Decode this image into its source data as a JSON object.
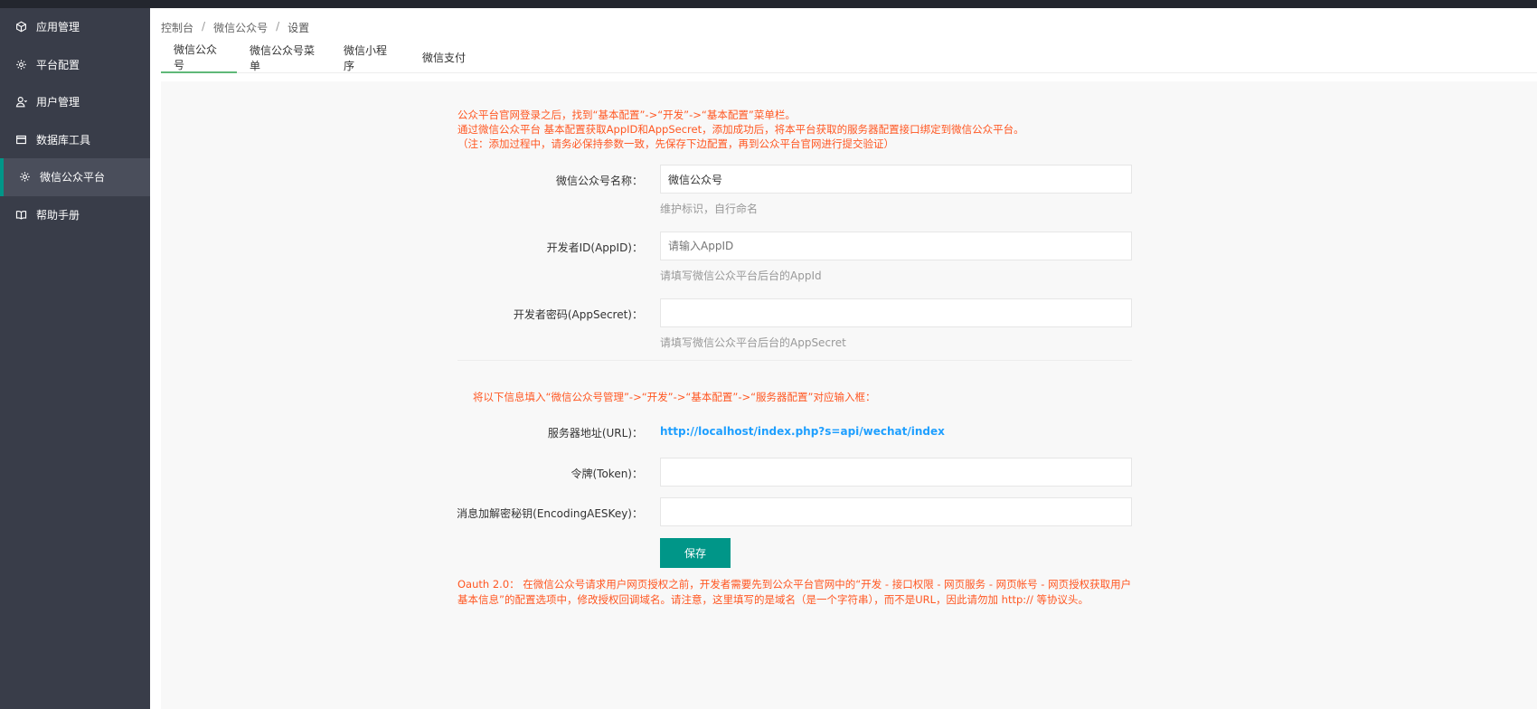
{
  "sidebar": {
    "items": [
      {
        "label": "应用管理",
        "icon": "cube-icon"
      },
      {
        "label": "平台配置",
        "icon": "gear-icon"
      },
      {
        "label": "用户管理",
        "icon": "user-icon"
      },
      {
        "label": "数据库工具",
        "icon": "window-icon"
      },
      {
        "label": "微信公众平台",
        "icon": "gear-icon",
        "active": true
      },
      {
        "label": "帮助手册",
        "icon": "book-icon"
      }
    ]
  },
  "breadcrumb": [
    "控制台",
    "微信公众号",
    "设置"
  ],
  "breadcrumb_sep": "/",
  "tabs": [
    "微信公众号",
    "微信公众号菜单",
    "微信小程序",
    "微信支付"
  ],
  "notice_top": [
    "公众平台官网登录之后，找到“基本配置”->“开发”->“基本配置”菜单栏。",
    "通过微信公众平台 基本配置获取AppID和AppSecret，添加成功后，将本平台获取的服务器配置接口绑定到微信公众平台。",
    "（注：添加过程中，请务必保持参数一致，先保存下边配置，再到公众平台官网进行提交验证）"
  ],
  "form": {
    "name": {
      "label": "微信公众号名称：",
      "value": "微信公众号",
      "hint": "维护标识，自行命名"
    },
    "appid": {
      "label": "开发者ID(AppID)：",
      "placeholder": "请输入AppID",
      "hint": "请填写微信公众平台后台的AppId"
    },
    "appsecret": {
      "label": "开发者密码(AppSecret)：",
      "value": "",
      "hint": "请填写微信公众平台后台的AppSecret"
    }
  },
  "notice_mid": "将以下信息填入“微信公众号管理”->“开发”->“基本配置”->“服务器配置”对应输入框：",
  "server": {
    "url_label": "服务器地址(URL)：",
    "url_value": "http://localhost/index.php?s=api/wechat/index",
    "token_label": "令牌(Token)：",
    "aes_label": "消息加解密秘钥(EncodingAESKey)："
  },
  "save_label": "保存",
  "oauth_notice": [
    "Oauth 2.0：  在微信公众号请求用户网页授权之前，开发者需要先到公众平台官网中的“开发 - 接口权限 - 网页服务 - 网页帐号 - 网页授权获取用户",
    "基本信息”的配置选项中，修改授权回调域名。请注意，这里填写的是域名（是一个字符串），而不是URL，因此请勿加 http:// 等协议头。"
  ],
  "colors": {
    "sidebar_bg": "#393d49",
    "accent": "#009688",
    "notice": "#ff5722",
    "link": "#1e9fff",
    "tab_active": "#5fb878"
  }
}
